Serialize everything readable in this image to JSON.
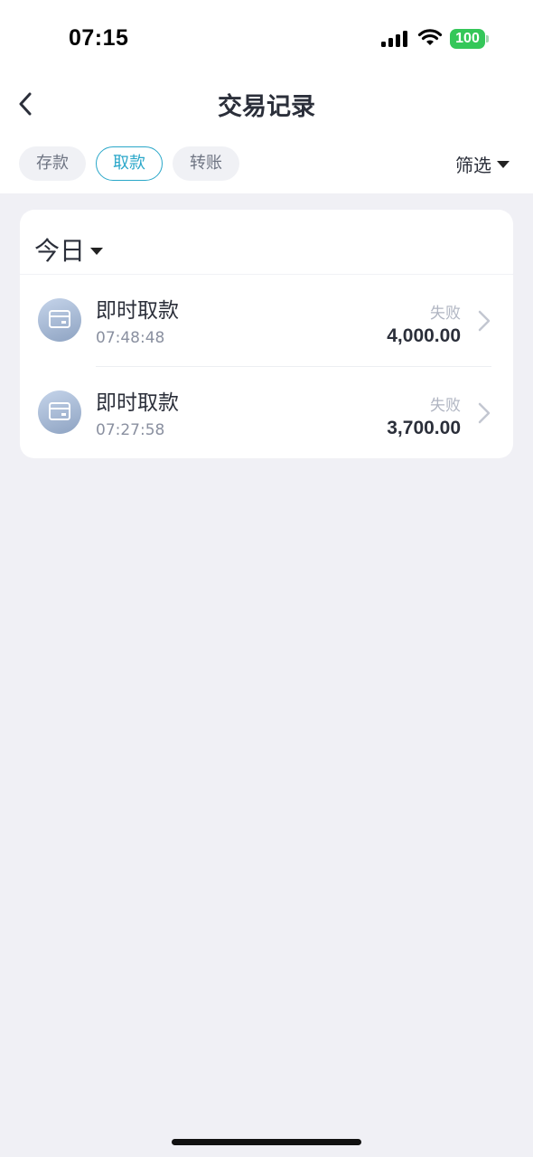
{
  "status_bar": {
    "time": "07:15",
    "battery": "100",
    "icons": [
      "signal-icon",
      "wifi-icon",
      "battery-icon"
    ]
  },
  "header": {
    "title": "交易记录",
    "back_icon": "chevron-left-icon"
  },
  "tabs": [
    {
      "label": "存款",
      "active": false
    },
    {
      "label": "取款",
      "active": true
    },
    {
      "label": "转账",
      "active": false
    }
  ],
  "filter": {
    "label": "筛选",
    "icon": "caret-down-icon"
  },
  "date_section": {
    "label": "今日",
    "icon": "caret-down-icon"
  },
  "transactions": [
    {
      "title": "即时取款",
      "time": "07:48:48",
      "status": "失败",
      "amount": "4,000.00",
      "icon": "card-icon"
    },
    {
      "title": "即时取款",
      "time": "07:27:58",
      "status": "失败",
      "amount": "3,700.00",
      "icon": "card-icon"
    }
  ],
  "colors": {
    "accent": "#2aa7c9",
    "battery_green": "#34c759",
    "page_background": "#f0f0f5"
  }
}
